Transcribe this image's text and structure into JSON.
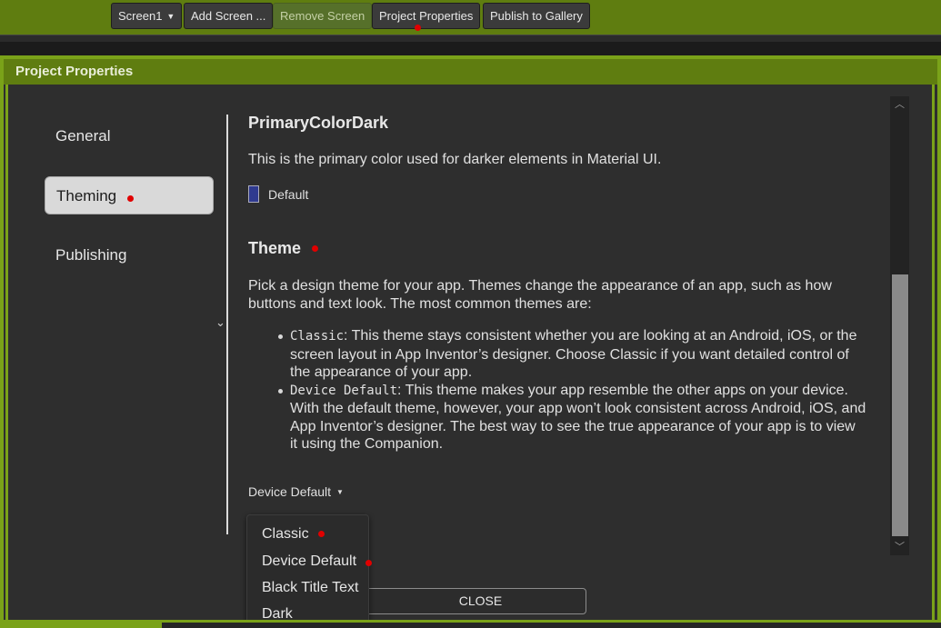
{
  "toolbar": {
    "screen_select": "Screen1",
    "add_screen": "Add Screen ...",
    "remove_screen": "Remove Screen",
    "project_properties": "Project Properties",
    "publish": "Publish to Gallery"
  },
  "dialog": {
    "title": "Project Properties",
    "close_label": "CLOSE"
  },
  "sidebar": {
    "items": [
      {
        "label": "General"
      },
      {
        "label": "Theming"
      },
      {
        "label": "Publishing"
      }
    ]
  },
  "content": {
    "primary_color_dark": {
      "heading": "PrimaryColorDark",
      "description": "This is the primary color used for darker elements in Material UI.",
      "value": "Default",
      "swatch_color": "#2f3a8f"
    },
    "theme": {
      "heading": "Theme",
      "description": "Pick a design theme for your app. Themes change the appearance of an app, such as how buttons and text look. The most common themes are:",
      "bullets": [
        {
          "term": "Classic",
          "text": ": This theme stays consistent whether you are looking at an Android, iOS, or the screen layout in App Inventor’s designer. Choose Classic if you want detailed control of the appearance of your app."
        },
        {
          "term": "Device Default",
          "text": ": This theme makes your app resemble the other apps on your device. With the default theme, however, your app won’t look consistent across Android, iOS, and App Inventor’s designer. The best way to see the true appearance of your app is to view it using the Companion."
        }
      ],
      "selected": "Device Default",
      "options": [
        "Classic",
        "Device Default",
        "Black Title Text",
        "Dark"
      ]
    }
  },
  "colors": {
    "accent": "#7aa219",
    "toolbar": "#5f7d10",
    "marker": "#e00000"
  }
}
